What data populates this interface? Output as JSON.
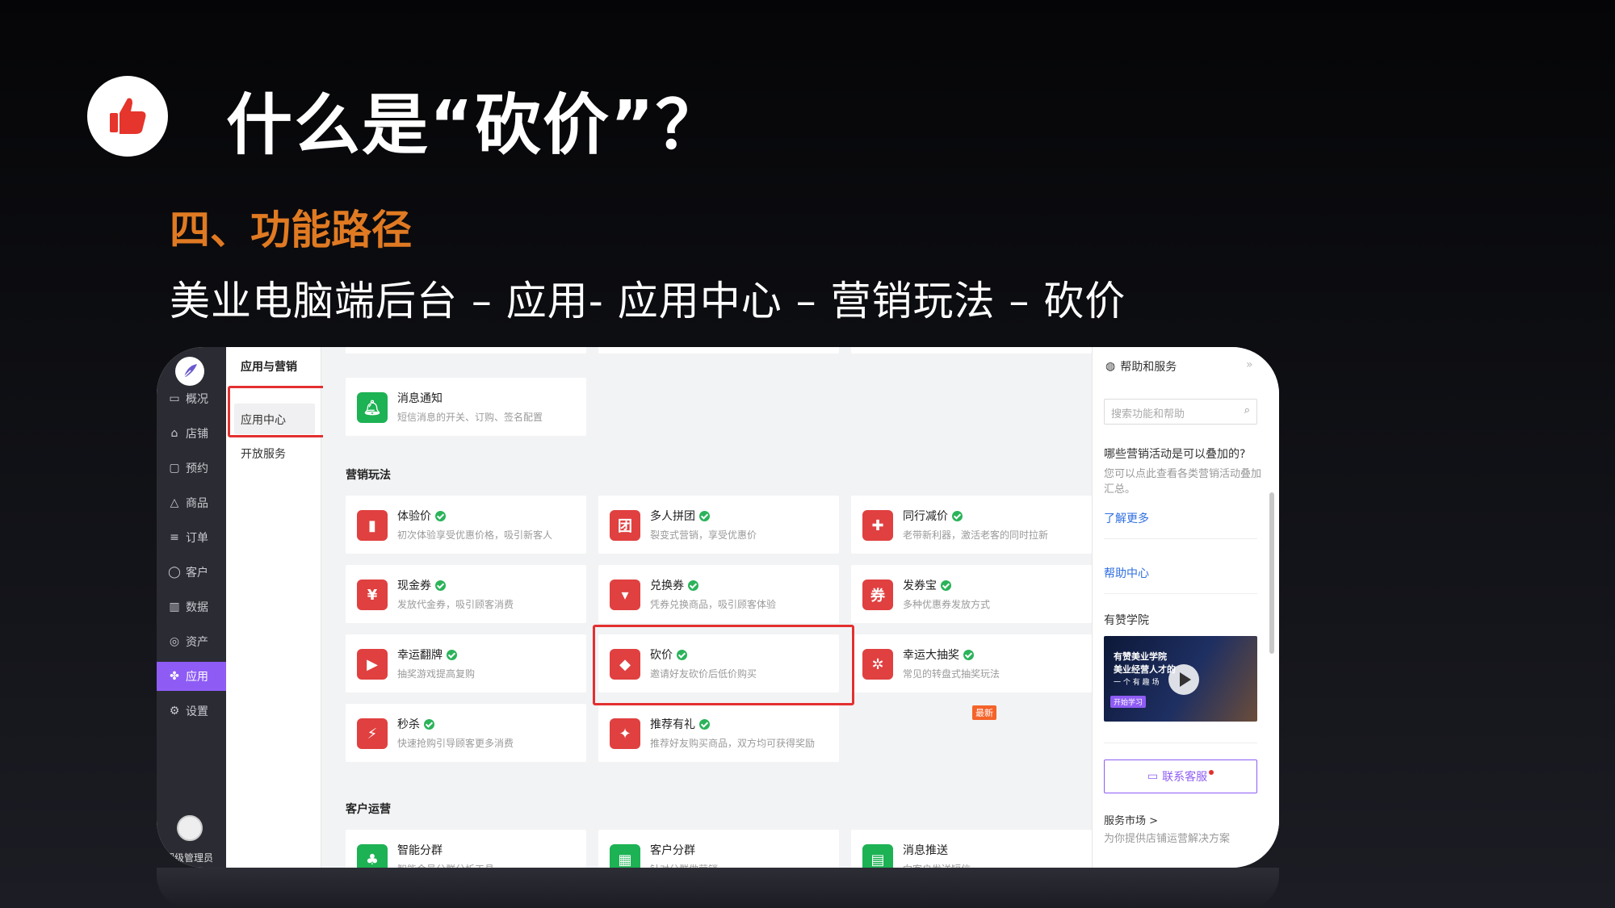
{
  "slide": {
    "title": "什么是“砍价”？",
    "section": "四、功能路径",
    "path": "美业电脑端后台  –  应用- 应用中心 – 营销玩法 –  砍价"
  },
  "colors": {
    "accent": "#8e5cf5",
    "highlight": "#e33030",
    "section": "#e07a22",
    "check": "#2bb35a",
    "icon_red": "#e04040",
    "icon_green": "#1db254"
  },
  "nav": {
    "items": [
      {
        "label": "概况",
        "icon": "monitor-icon"
      },
      {
        "label": "店铺",
        "icon": "store-icon"
      },
      {
        "label": "预约",
        "icon": "calendar-icon"
      },
      {
        "label": "商品",
        "icon": "bag-icon"
      },
      {
        "label": "订单",
        "icon": "list-icon"
      },
      {
        "label": "客户",
        "icon": "user-icon"
      },
      {
        "label": "数据",
        "icon": "chart-icon"
      },
      {
        "label": "资产",
        "icon": "coin-icon"
      },
      {
        "label": "应用",
        "icon": "apps-icon"
      },
      {
        "label": "设置",
        "icon": "gear-icon"
      }
    ],
    "user": "超级管理员"
  },
  "subnav": {
    "title": "应用与营销",
    "items": [
      "应用中心",
      "开放服务"
    ]
  },
  "main": {
    "notice": {
      "name": "消息通知",
      "desc": "短信消息的开关、订购、签名配置"
    },
    "marketing_label": "营销玩法",
    "marketing": [
      {
        "name": "体验价",
        "desc": "初次体验享受优惠价格，吸引新客人",
        "icon": "tag-icon",
        "glyph": "▮"
      },
      {
        "name": "多人拼团",
        "desc": "裂变式营销，享受优惠价",
        "icon": "group-icon",
        "glyph": "团"
      },
      {
        "name": "同行减价",
        "desc": "老带新利器，激活老客的同时拉新",
        "icon": "users-icon",
        "glyph": "✚"
      },
      {
        "name": "现金券",
        "desc": "发放代金券，吸引顾客消费",
        "icon": "cash-coupon-icon",
        "glyph": "¥"
      },
      {
        "name": "兑换券",
        "desc": "凭券兑换商品，吸引顾客体验",
        "icon": "exchange-coupon-icon",
        "glyph": "▾"
      },
      {
        "name": "发券宝",
        "desc": "多种优惠券发放方式",
        "icon": "coupon-icon",
        "glyph": "券"
      },
      {
        "name": "幸运翻牌",
        "desc": "抽奖游戏提高复购",
        "icon": "card-flip-icon",
        "glyph": "▶"
      },
      {
        "name": "砍价",
        "desc": "邀请好友砍价后低价购买",
        "icon": "knife-icon",
        "glyph": "◆"
      },
      {
        "name": "幸运大抽奖",
        "desc": "常见的转盘式抽奖玩法",
        "icon": "wheel-icon",
        "glyph": "✲"
      },
      {
        "name": "秒杀",
        "desc": "快速抢购引导顾客更多消费",
        "icon": "lightning-icon",
        "glyph": "⚡"
      },
      {
        "name": "推荐有礼",
        "desc": "推荐好友购买商品，双方均可获得奖励",
        "icon": "gift-icon",
        "glyph": "✦"
      }
    ],
    "new_badge": "最新",
    "customer_label": "客户运营",
    "customer": [
      {
        "name": "智能分群",
        "desc": "智能会员分群分析工具",
        "icon": "tree-icon",
        "glyph": "♣"
      },
      {
        "name": "客户分群",
        "desc": "针对分群做营销",
        "icon": "segment-icon",
        "glyph": "▦"
      },
      {
        "name": "消息推送",
        "desc": "向客户发送短信",
        "icon": "message-icon",
        "glyph": "▤"
      }
    ]
  },
  "help": {
    "title": "帮助和服务",
    "search_placeholder": "搜索功能和帮助",
    "question": "哪些营销活动是可以叠加的?",
    "answer": "您可以点此查看各类营销活动叠加汇总。",
    "learn_more": "了解更多",
    "help_center": "帮助中心",
    "academy": "有赞学院",
    "video_text_1": "有赞美业学院",
    "video_text_2": "美业经营人才的",
    "video_text_3": "一 个 有 趣 场",
    "video_btn": "开始学习",
    "contact": "联系客服",
    "market": "服务市场 >",
    "market_desc": "为你提供店铺运营解决方案"
  }
}
